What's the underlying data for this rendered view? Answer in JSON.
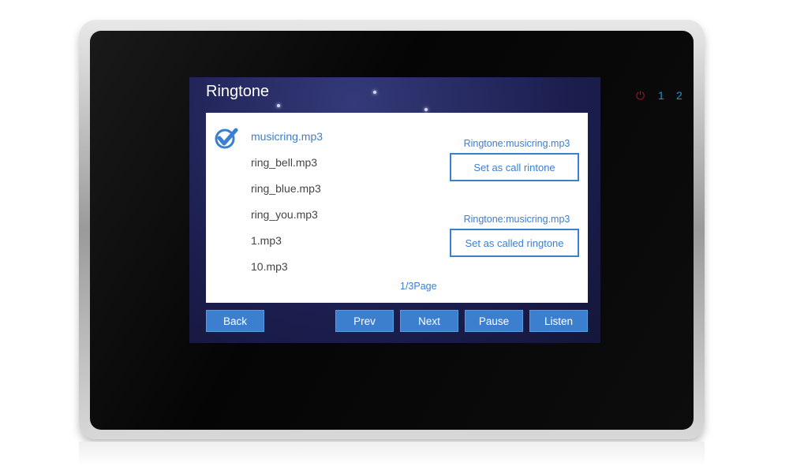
{
  "screen": {
    "title": "Ringtone"
  },
  "files": [
    {
      "name": "musicring.mp3",
      "selected": true
    },
    {
      "name": "ring_bell.mp3",
      "selected": false
    },
    {
      "name": "ring_blue.mp3",
      "selected": false
    },
    {
      "name": "ring_you.mp3",
      "selected": false
    },
    {
      "name": "1.mp3",
      "selected": false
    },
    {
      "name": "10.mp3",
      "selected": false
    }
  ],
  "call_ringtone": {
    "label": "Ringtone:musicring.mp3",
    "button": "Set as call rintone"
  },
  "called_ringtone": {
    "label": "Ringtone:musicring.mp3",
    "button": "Set as called ringtone"
  },
  "pagination": "1/3Page",
  "buttons": {
    "back": "Back",
    "prev": "Prev",
    "next": "Next",
    "pause": "Pause",
    "listen": "Listen"
  },
  "indicators": {
    "power_icon": "power-icon",
    "line1": "1",
    "line2": "2",
    "power_color": "#a01c2a",
    "line_color": "#2a8fd0"
  },
  "accent": "#3a7fd0"
}
